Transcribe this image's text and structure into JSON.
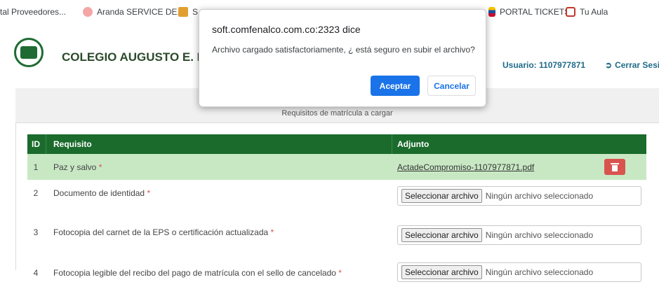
{
  "bookmarks": [
    {
      "label": "tal Proveedores...",
      "icon": "page-icon"
    },
    {
      "label": "Aranda SERVICE DE...",
      "icon": "aranda-icon"
    },
    {
      "label": "S",
      "icon": "people-icon"
    },
    {
      "label": "PORTAL TICKETS",
      "icon": "flag-icon"
    },
    {
      "label": "Tu Aula",
      "icon": "book-icon"
    }
  ],
  "header": {
    "school_name": "COLEGIO AUGUSTO E. MED",
    "user": "Usuario: 1107977871",
    "logout": "Cerrar Sesi"
  },
  "panel": {
    "title": "Requisitos de matrícula a cargar"
  },
  "table": {
    "headers": {
      "id": "ID",
      "requirement": "Requisito",
      "attachment": "Adjunto"
    },
    "rows": [
      {
        "id": "1",
        "requirement": "Paz y salvo",
        "required_mark": "*",
        "file": "ActadeCompromiso-1107977871.pdf"
      },
      {
        "id": "2",
        "requirement": "Documento de identidad",
        "required_mark": "*",
        "button": "Seleccionar archivo",
        "status": "Ningún archivo seleccionado"
      },
      {
        "id": "3",
        "requirement": "Fotocopia del carnet de la EPS o certificación actualizada",
        "required_mark": "*",
        "button": "Seleccionar archivo",
        "status": "Ningún archivo seleccionado"
      },
      {
        "id": "4",
        "requirement": "Fotocopia legible del recibo del pago de matrícula con el sello de cancelado",
        "required_mark": "*",
        "button": "Seleccionar archivo",
        "status": "Ningún archivo seleccionado"
      }
    ]
  },
  "dialog": {
    "title": "soft.comfenalco.com.co:2323 dice",
    "message": "Archivo cargado satisfactoriamente, ¿ está seguro en subir el archivo?",
    "ok": "Aceptar",
    "cancel": "Cancelar"
  },
  "colors": {
    "table_header": "#1a6b2c",
    "uploaded_row": "#c8e8c4",
    "delete_button": "#d9534f",
    "dialog_primary": "#1a73e8"
  }
}
